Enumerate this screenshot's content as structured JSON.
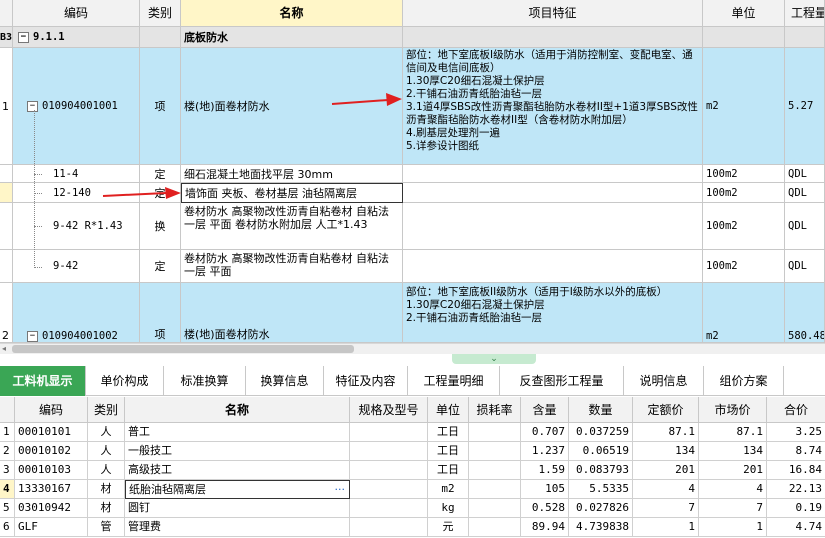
{
  "top_table": {
    "headers": {
      "code": "编码",
      "category": "类别",
      "name": "名称",
      "feature": "项目特征",
      "unit": "单位",
      "quantity": "工程量"
    },
    "group_row": {
      "index": "B3",
      "toggle": "−",
      "code": "9.1.1",
      "name": "底板防水"
    },
    "item1": {
      "index": "1",
      "toggle": "−",
      "code": "010904001001",
      "category": "项",
      "name": "楼(地)面卷材防水",
      "feature_lines": [
        "部位：地下室底板I级防水（适用于消防控制室、变配电室、通信间及电信间底板）",
        "1.30厚C20细石混凝土保护层",
        "2.干铺石油沥青纸胎油毡一层",
        "3.1道4厚SBS改性沥青聚酯毡胎防水卷材II型+1道3厚SBS改性沥青聚酯毡胎防水卷材II型（含卷材防水附加层）",
        "4.刷基层处理剂一遍",
        "5.详参设计图纸"
      ],
      "unit": "m2",
      "quantity": "5.27"
    },
    "sub_rows": [
      {
        "code": "11-4",
        "category": "定",
        "name": "细石混凝土地面找平层 30mm",
        "unit": "100m2",
        "quantity": "QDL"
      },
      {
        "code": "12-140",
        "category": "定",
        "name": "墙饰面 夹板、卷材基层 油毡隔离层",
        "unit": "100m2",
        "quantity": "QDL"
      },
      {
        "code": "9-42 R*1.43",
        "category": "换",
        "name": "卷材防水 高聚物改性沥青自粘卷材 自粘法一层 平面  卷材防水附加层 人工*1.43",
        "unit": "100m2",
        "quantity": "QDL"
      },
      {
        "code": "9-42",
        "category": "定",
        "name": "卷材防水 高聚物改性沥青自粘卷材 自粘法一层 平面",
        "unit": "100m2",
        "quantity": "QDL"
      }
    ],
    "item2": {
      "index": "2",
      "toggle": "−",
      "code": "010904001002",
      "category": "项",
      "name": "楼(地)面卷材防水",
      "feature_lines": [
        "部位：地下室底板II级防水（适用于I级防水以外的底板）",
        "1.30厚C20细石混凝土保护层",
        "2.干铺石油沥青纸胎油毡一层"
      ],
      "unit": "m2",
      "quantity": "580.48"
    }
  },
  "tabs": [
    "工料机显示",
    "单价构成",
    "标准换算",
    "换算信息",
    "特征及内容",
    "工程量明细",
    "反查图形工程量",
    "说明信息",
    "组价方案"
  ],
  "bottom_table": {
    "headers": {
      "code": "编码",
      "category": "类别",
      "name": "名称",
      "spec": "规格及型号",
      "unit": "单位",
      "loss": "损耗率",
      "content": "含量",
      "amount": "数量",
      "fixed_price": "定额价",
      "market_price": "市场价",
      "total": "合价"
    },
    "rows": [
      {
        "index": "1",
        "code": "00010101",
        "category": "人",
        "name": "普工",
        "spec": "",
        "unit": "工日",
        "loss": "",
        "content": "0.707",
        "amount": "0.037259",
        "fixed_price": "87.1",
        "market_price": "87.1",
        "total": "3.25"
      },
      {
        "index": "2",
        "code": "00010102",
        "category": "人",
        "name": "一般技工",
        "spec": "",
        "unit": "工日",
        "loss": "",
        "content": "1.237",
        "amount": "0.06519",
        "fixed_price": "134",
        "market_price": "134",
        "total": "8.74"
      },
      {
        "index": "3",
        "code": "00010103",
        "category": "人",
        "name": "高级技工",
        "spec": "",
        "unit": "工日",
        "loss": "",
        "content": "1.59",
        "amount": "0.083793",
        "fixed_price": "201",
        "market_price": "201",
        "total": "16.84"
      },
      {
        "index": "4",
        "code": "13330167",
        "category": "材",
        "name": "纸胎油毡隔离层",
        "spec": "",
        "unit": "m2",
        "loss": "",
        "content": "105",
        "amount": "5.5335",
        "fixed_price": "4",
        "market_price": "4",
        "total": "22.13"
      },
      {
        "index": "5",
        "code": "03010942",
        "category": "材",
        "name": "圆钉",
        "spec": "",
        "unit": "kg",
        "loss": "",
        "content": "0.528",
        "amount": "0.027826",
        "fixed_price": "7",
        "market_price": "7",
        "total": "0.19"
      },
      {
        "index": "6",
        "code": "GLF",
        "category": "管",
        "name": "管理费",
        "spec": "",
        "unit": "元",
        "loss": "",
        "content": "89.94",
        "amount": "4.739838",
        "fixed_price": "1",
        "market_price": "1",
        "total": "4.74"
      }
    ],
    "ellipsis": "···"
  },
  "colors": {
    "selected_row": "#bfe6f7",
    "name_header": "#fff6c8",
    "active_tab": "#3aa655",
    "arrow": "#e02020"
  }
}
